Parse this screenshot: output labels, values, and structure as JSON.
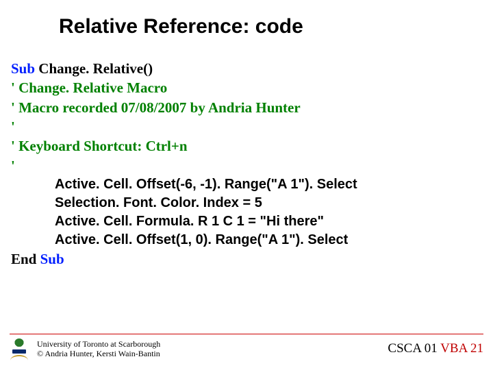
{
  "title": "Relative Reference: code",
  "code": {
    "sub_kw": "Sub",
    "sub_name": " Change. Relative()",
    "c1": "' Change. Relative Macro",
    "c2": "' Macro recorded 07/08/2007 by Andria Hunter",
    "c3": "'",
    "c4": "' Keyboard Shortcut: Ctrl+n",
    "c5": "'",
    "b1": "Active. Cell. Offset(-6, -1). Range(\"A 1\"). Select",
    "b2": "Selection. Font. Color. Index = 5",
    "b3": "Active. Cell. Formula. R 1 C 1 = \"Hi there\"",
    "b4": "Active. Cell. Offset(1, 0). Range(\"A 1\"). Select",
    "end_sub_kw": "End Sub",
    "end_sub_pre": "End ",
    "end_sub_post": "Sub"
  },
  "footer": {
    "uni": "University of Toronto at Scarborough",
    "copy": "© Andria Hunter, Kersti Wain-Bantin",
    "course": "CSCA 01 ",
    "vba": "VBA",
    "page": " 21"
  }
}
